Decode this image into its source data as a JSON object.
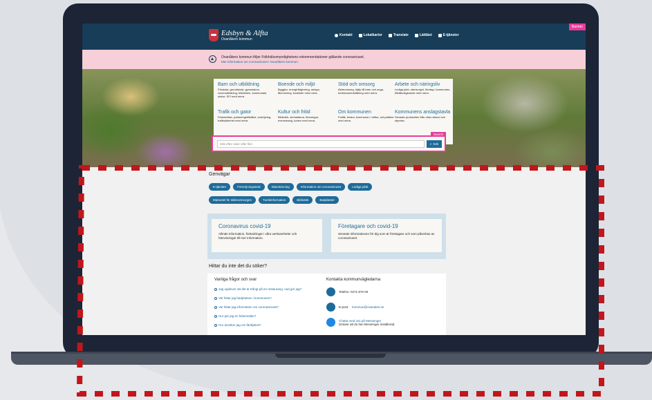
{
  "site": {
    "logo_title": "Edsbyn & Alfta",
    "logo_sub": "Ovanåkers kommun",
    "banner_tag": "Banner",
    "nav": [
      {
        "label": "Kontakt"
      },
      {
        "label": "Lokalkartor"
      },
      {
        "label": "Translate"
      },
      {
        "label": "Lättläst"
      },
      {
        "label": "E-tjänster"
      }
    ]
  },
  "alert": {
    "title": "Ovanåkers kommun följer Folkhälsomyndighetens rekommendationer gällande coronaviruset.",
    "link": "Mer information om coronaviruset i Ovanåkers kommun."
  },
  "menu": [
    {
      "title": "Barn och utbildning",
      "desc": "Förskola, grundskola, gymnasium, vuxenutbildning, fritidshem, kommunala skolor, SFI med mera."
    },
    {
      "title": "Boende och miljö",
      "desc": "Bygglov, energirådgivning, avlopp, återvinning, bostäder med mera."
    },
    {
      "title": "Stöd och omsorg",
      "desc": "Äldreomsorg, hjälp till barn och unga, funktionsnedsättning med mera."
    },
    {
      "title": "Arbete och näringsliv",
      "desc": "Lediga jobb, starta eget, företag i kommunen, tillståndsgivande med mera."
    },
    {
      "title": "Trafik och gator",
      "desc": "Felanmälan, parkeringstillstånd, snöröjning, trafiksäkerhet med mera."
    },
    {
      "title": "Kultur och fritid",
      "desc": "Bibliotek, simhallarna, föreningar, evenemang, turism med mera."
    },
    {
      "title": "Om kommunen",
      "desc": "Politik, beslut, kommunen i siffror, söt politiker med mera."
    },
    {
      "title": "Kommunens anslagstavla",
      "desc": "Senaste protokollen från våra nämnd och styrelse."
    }
  ],
  "search": {
    "tag": "Search",
    "placeholder": "Sök efter sidor eller filer",
    "button": "Sök"
  },
  "shortcuts": {
    "title": "Genvägar",
    "row1": [
      "E-tjänster",
      "Försörjningsstöd",
      "Slamtömning",
      "Information om coronaviruset",
      "Lediga jobb"
    ],
    "row2": [
      "Matsedel för äldreomsorgen",
      "Turistinformation",
      "Bibliotek",
      "Badplatser"
    ]
  },
  "cards": [
    {
      "title": "Coronavirus covid-19",
      "desc": "Allmän information, förändringar i våra verksamheter och hänvisningar till mer information."
    },
    {
      "title": "Företagare och covid-19",
      "desc": "Senaste informationen för dig som är företagare och som påverkas av coronaviruset."
    }
  ],
  "find": {
    "title": "Hittar du inte det du söker?",
    "faq_title": "Vanliga frågor och svar",
    "faq": [
      "Jag upplever att det är trångt på en restaurang, vad gör jag?",
      "Var hittar jag badplatsen i kommunen?",
      "Var hittar jag information om coronaviruset?",
      "Hur gör jag en felanmälan?",
      "Hur ansöker jag om färdtjänst?"
    ],
    "contact_title": "Kontakta kommunvägledarna",
    "phone": "Telefon: 0271-570 00",
    "email_prefix": "E-post:",
    "email": "kommun@ovanaker.se",
    "messenger_link": "Chatta med oss på Messenger",
    "messenger_note": "(Kräver att du har Messenger installerat)"
  },
  "colors": {
    "header": "#173d58",
    "accent": "#1d6b9a",
    "highlight": "#e63d9a",
    "alert": "#f6cfd8",
    "dash": "#c0161c"
  }
}
